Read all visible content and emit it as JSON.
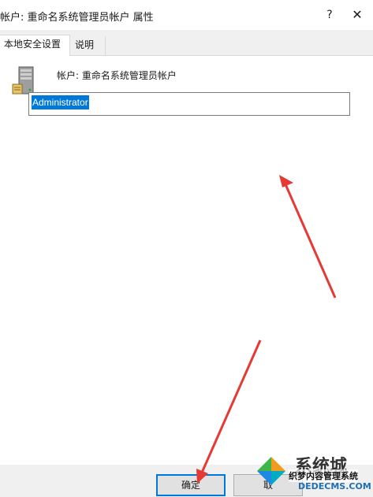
{
  "window": {
    "title": "帐户: 重命名系统管理员帐户 属性",
    "help_glyph": "?",
    "close_glyph": "✕"
  },
  "tabs": [
    {
      "label": "本地安全设置",
      "active": true
    },
    {
      "label": "说明",
      "active": false
    }
  ],
  "policy": {
    "icon": "server-icon",
    "name": "帐户: 重命名系统管理员帐户"
  },
  "account_name_field": {
    "value": "Administrator",
    "selected": true
  },
  "footer": {
    "ok_label": "确定",
    "cancel_label": "取"
  },
  "watermark": {
    "brand_fragment": "系统城",
    "site_name": "织梦内容管理系统",
    "url": "DEDECMS.COM"
  },
  "colors": {
    "selection": "#0078d7",
    "annotation_arrow": "#e53935",
    "dialog_bg": "#f0f0f0"
  }
}
